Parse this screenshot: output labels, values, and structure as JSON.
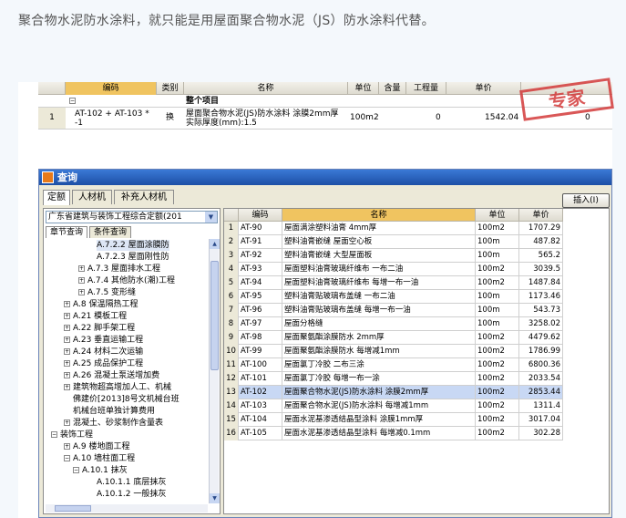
{
  "caption": "聚合物水泥防水涂料，就只能是用屋面聚合物水泥（JS）防水涂料代替。",
  "top_grid": {
    "headers": {
      "code": "编码",
      "category": "类别",
      "name": "名称",
      "unit": "单位",
      "content": "含量",
      "quantity": "工程量",
      "price": "单价"
    },
    "group_label": "整个项目",
    "row": {
      "index": "1",
      "code": "AT-102 + AT-103 * -1",
      "category": "换",
      "name": "屋面聚合物水泥(JS)防水涂料 涂膜2mm厚 实际厚度(mm):1.5",
      "unit": "100m2",
      "quantity": "0",
      "price": "1542.04",
      "last": "0"
    }
  },
  "stamp_text": "专家",
  "dialog": {
    "title": "查询",
    "tabs": [
      "定额",
      "人材机",
      "补充人材机"
    ],
    "insert_button": "插入(I)",
    "combo_value": "广东省建筑与装饰工程综合定额(201",
    "subtabs": [
      "章节查询",
      "条件查询"
    ],
    "tree": [
      {
        "text": "A.7.2.2 屋面涂膜防",
        "box": "",
        "sel": true
      },
      {
        "text": "A.7.2.3 屋面刚性防",
        "box": ""
      },
      {
        "text": "A.7.3 屋面排水工程",
        "box": "+"
      },
      {
        "text": "A.7.4 其他防水(潮)工程",
        "box": "+"
      },
      {
        "text": "A.7.5 变形缝",
        "box": "+"
      },
      {
        "text": "A.8 保温隔热工程",
        "box": "+"
      },
      {
        "text": "A.21 模板工程",
        "box": "+"
      },
      {
        "text": "A.22 脚手架工程",
        "box": "+"
      },
      {
        "text": "A.23 垂直运输工程",
        "box": "+"
      },
      {
        "text": "A.24 材料二次运输",
        "box": "+"
      },
      {
        "text": "A.25 成品保护工程",
        "box": "+"
      },
      {
        "text": "A.26 混凝土泵送增加费",
        "box": "+"
      },
      {
        "text": "建筑物超高增加人工、机械",
        "box": "+"
      },
      {
        "text": "佛建价[2013]8号文机械台班",
        "box": ""
      },
      {
        "text": "机械台班单独计算费用",
        "box": ""
      },
      {
        "text": "混凝土、砂浆制作含量表",
        "box": "+"
      },
      {
        "text": "装饰工程",
        "box": "-"
      },
      {
        "text": "A.9 楼地面工程",
        "box": "+"
      },
      {
        "text": "A.10 墙柱面工程",
        "box": "-"
      },
      {
        "text": "A.10.1 抹灰",
        "box": "-"
      },
      {
        "text": "A.10.1.1 底层抹灰",
        "box": ""
      },
      {
        "text": "A.10.1.2 一般抹灰",
        "box": ""
      }
    ],
    "grid_headers": {
      "code": "编码",
      "name": "名称",
      "unit": "单位",
      "price": "单价"
    },
    "rows": [
      {
        "i": "1",
        "code": "AT-90",
        "name": "屋面满涂塑料油膏 4mm厚",
        "unit": "100m2",
        "price": "1707.29"
      },
      {
        "i": "2",
        "code": "AT-91",
        "name": "塑料油膏嵌缝 屋面空心板",
        "unit": "100m",
        "price": "487.82"
      },
      {
        "i": "3",
        "code": "AT-92",
        "name": "塑料油膏嵌缝 大型屋面板",
        "unit": "100m",
        "price": "565.2"
      },
      {
        "i": "4",
        "code": "AT-93",
        "name": "屋面塑料油膏玻璃纤维布 一布二油",
        "unit": "100m2",
        "price": "3039.5"
      },
      {
        "i": "5",
        "code": "AT-94",
        "name": "屋面塑料油膏玻璃纤维布 每增一布一油",
        "unit": "100m2",
        "price": "1487.84"
      },
      {
        "i": "6",
        "code": "AT-95",
        "name": "塑料油膏贴玻璃布盖缝 一布二油",
        "unit": "100m",
        "price": "1173.46"
      },
      {
        "i": "7",
        "code": "AT-96",
        "name": "塑料油膏贴玻璃布盖缝 每增一布一油",
        "unit": "100m",
        "price": "543.73"
      },
      {
        "i": "8",
        "code": "AT-97",
        "name": "屋面分格缝",
        "unit": "100m",
        "price": "3258.02"
      },
      {
        "i": "9",
        "code": "AT-98",
        "name": "屋面聚氨酯涂膜防水 2mm厚",
        "unit": "100m2",
        "price": "4479.62"
      },
      {
        "i": "10",
        "code": "AT-99",
        "name": "屋面聚氨酯涂膜防水 每增减1mm",
        "unit": "100m2",
        "price": "1786.99"
      },
      {
        "i": "11",
        "code": "AT-100",
        "name": "屋面氯丁冷胶 二布三涂",
        "unit": "100m2",
        "price": "6800.36"
      },
      {
        "i": "12",
        "code": "AT-101",
        "name": "屋面氯丁冷胶 每增一布一涂",
        "unit": "100m2",
        "price": "2033.54"
      },
      {
        "i": "13",
        "code": "AT-102",
        "name": "屋面聚合物水泥(JS)防水涂料 涂膜2mm厚",
        "unit": "100m2",
        "price": "2853.44",
        "sel": true
      },
      {
        "i": "14",
        "code": "AT-103",
        "name": "屋面聚合物水泥(JS)防水涂料 每增减1mm",
        "unit": "100m2",
        "price": "1311.4"
      },
      {
        "i": "15",
        "code": "AT-104",
        "name": "屋面水泥基渗透结晶型涂料 涂膜1mm厚",
        "unit": "100m2",
        "price": "3017.04"
      },
      {
        "i": "16",
        "code": "AT-105",
        "name": "屋面水泥基渗透结晶型涂料 每增减0.1mm",
        "unit": "100m2",
        "price": "302.28"
      }
    ]
  }
}
